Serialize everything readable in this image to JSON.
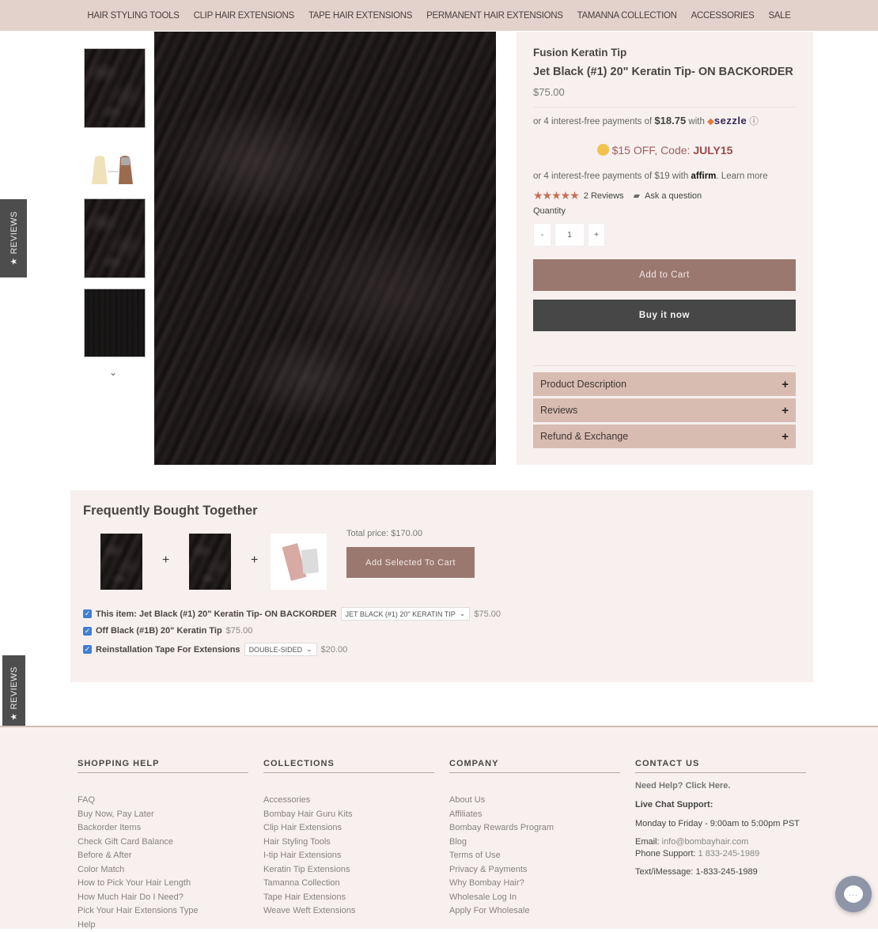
{
  "nav": {
    "items": [
      "HAIR STYLING TOOLS",
      "CLIP HAIR EXTENSIONS",
      "TAPE HAIR EXTENSIONS",
      "PERMANENT HAIR EXTENSIONS",
      "TAMANNA COLLECTION",
      "ACCESSORIES",
      "SALE"
    ]
  },
  "reviews_tab": {
    "label": "REVIEWS",
    "icon": "star-icon"
  },
  "gallery": {
    "thumbnails": [
      "jet-black-wavy-hair",
      "keratin-tip-bundles",
      "jet-black-wavy-hair",
      "jet-black-straight-hair"
    ],
    "more_icon": "chevron-down-icon"
  },
  "product": {
    "category": "Fusion Keratin Tip",
    "title": "Jet Black (#1) 20\" Keratin Tip- ON BACKORDER",
    "price": "$75.00",
    "sezzle": {
      "prefix": "or 4 interest-free payments of",
      "amount": "$18.75",
      "with": "with",
      "brand": "sezzle",
      "info_icon": "ⓘ"
    },
    "promo": {
      "text": "$15 OFF, Code:",
      "code": "JULY15"
    },
    "affirm": {
      "prefix": "or 4 interest-free payments of $19 with",
      "brand": "affirm",
      "suffix": ". Learn more"
    },
    "rating": {
      "stars": "★★★★★",
      "reviews": "2 Reviews",
      "ask": "Ask a question"
    },
    "quantity": {
      "label": "Quantity",
      "minus": "-",
      "value": "1",
      "plus": "+"
    },
    "add_to_cart": "Add to Cart",
    "buy_now": "Buy it now",
    "accordions": [
      {
        "label": "Product Description",
        "icon": "+"
      },
      {
        "label": "Reviews",
        "icon": "+"
      },
      {
        "label": "Refund & Exchange",
        "icon": "+"
      }
    ]
  },
  "fbt": {
    "title": "Frequently Bought Together",
    "plus": "+",
    "total": "Total price: $170.00",
    "add_selected": "Add Selected To Cart",
    "items": [
      {
        "checked": true,
        "name": "This item: Jet Black (#1) 20\" Keratin Tip- ON BACKORDER",
        "select": "JET BLACK (#1) 20\" KERATIN TIP",
        "price": "$75.00"
      },
      {
        "checked": true,
        "name": "Off Black (#1B) 20\" Keratin Tip",
        "price": "$75.00"
      },
      {
        "checked": true,
        "name": "Reinstallation Tape For Extensions",
        "select": "DOUBLE-SIDED",
        "price": "$20.00"
      }
    ]
  },
  "footer": {
    "shopping_help": {
      "title": "SHOPPING HELP",
      "links": [
        "FAQ",
        "Buy Now, Pay Later",
        "Backorder Items",
        "Check Gift Card Balance",
        "Before & After",
        "Color Match",
        "How to Pick Your Hair Length",
        "How Much Hair Do I Need?",
        "Pick Your Hair Extensions Type",
        "Help"
      ]
    },
    "collections": {
      "title": "COLLECTIONS",
      "links": [
        "Accessories",
        "Bombay Hair Guru Kits",
        "Clip Hair Extensions",
        "Hair Styling Tools",
        "I-tip Hair Extensions",
        "Keratin Tip Extensions",
        "Tamanna Collection",
        "Tape Hair Extensions",
        "Weave Weft Extensions"
      ]
    },
    "company": {
      "title": "COMPANY",
      "links": [
        "About Us",
        "Affiliates",
        "Bombay Rewards Program",
        "Blog",
        "Terms of Use",
        "Privacy & Payments",
        "Why Bombay Hair?",
        "Wholesale Log In",
        "Apply For Wholesale"
      ]
    },
    "contact": {
      "title": "CONTACT US",
      "need_help": "Need Help? Click Here.",
      "live_chat": "Live Chat Support:",
      "hours": "Monday to Friday - 9:00am to 5:00pm PST",
      "email_label": "Email:",
      "email": "info@bombayhair.com",
      "phone_label": "Phone Support:",
      "phone": "1 833-245-1989",
      "text_label": "Text/iMessage:",
      "text": "1-833-245-1989"
    }
  },
  "chat_widget": {
    "icon": "chat-bubble-icon",
    "glyph": "..."
  }
}
